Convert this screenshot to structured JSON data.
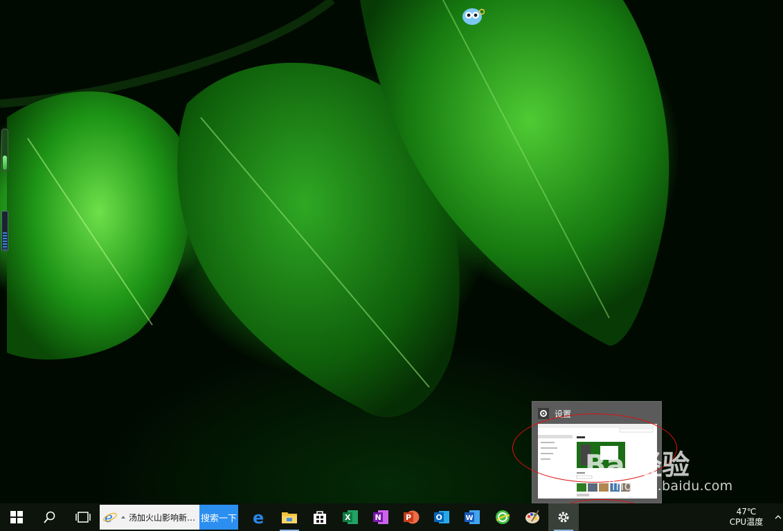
{
  "window_thumbnail": {
    "title": "设置"
  },
  "taskbar": {
    "search_box_text": "汤加火山影响新…",
    "search_button": "搜索一下",
    "apps": [
      {
        "name": "edge",
        "letter": "e"
      },
      {
        "name": "file-explorer"
      },
      {
        "name": "microsoft-store"
      },
      {
        "name": "excel",
        "letter": "X"
      },
      {
        "name": "onenote",
        "letter": "N"
      },
      {
        "name": "powerpoint",
        "letter": "P"
      },
      {
        "name": "outlook",
        "letter": "O"
      },
      {
        "name": "word",
        "letter": "W"
      },
      {
        "name": "browser-360"
      },
      {
        "name": "paint"
      },
      {
        "name": "settings"
      }
    ],
    "tray": {
      "cpu_temp": "47℃",
      "cpu_label": "CPU温度"
    }
  },
  "watermark": {
    "brand": "Bai经验",
    "url": "jingyan.baidu.com"
  },
  "gauges": {
    "left_gauge_1_level": 0.35,
    "left_gauge_2_level": 0.45
  },
  "colors": {
    "taskbar_bg": "#0c140c",
    "search_button": "#2c8ff0",
    "annotation_red": "#dd1111"
  }
}
